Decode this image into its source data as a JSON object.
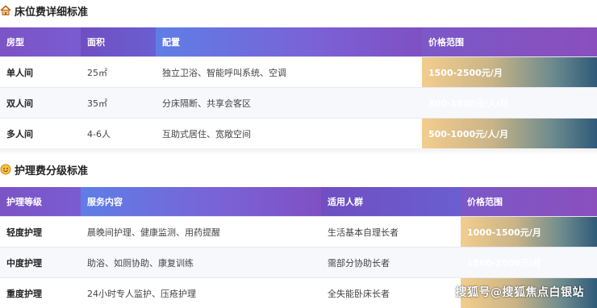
{
  "bed_section": {
    "title": "床位费详细标准",
    "icon": "house-icon",
    "headers": [
      "房型",
      "面积",
      "配置",
      "价格范围"
    ],
    "rows": [
      {
        "type": "单人间",
        "area": "25㎡",
        "config": "独立卫浴、智能呼叫系统、空调",
        "price": "1500-2500元/月"
      },
      {
        "type": "双人间",
        "area": "35㎡",
        "config": "分床隔断、共享会客区",
        "price": "800-1500元/人/月"
      },
      {
        "type": "多人间",
        "area": "4-6人",
        "config": "互助式居住、宽敞空间",
        "price": "500-1000元/人/月"
      }
    ]
  },
  "care_section": {
    "title": "护理费分级标准",
    "icon": "smile-coin-icon",
    "headers": [
      "护理等级",
      "服务内容",
      "适用人群",
      "价格范围"
    ],
    "rows": [
      {
        "level": "轻度护理",
        "service": "晨晚间护理、健康监测、用药提醒",
        "group": "生活基本自理长者",
        "price": "1000-1500元/月"
      },
      {
        "level": "中度护理",
        "service": "助浴、如厕协助、康复训练",
        "group": "需部分协助长者",
        "price": "1500-2500元/月"
      },
      {
        "level": "重度护理",
        "service": "24小时专人监护、压疮护理",
        "group": "全失能卧床长者",
        "price": ""
      }
    ]
  },
  "watermark": "搜狐号@搜狐焦点白银站",
  "colors": {
    "header_purple": "#6a5ed0",
    "price_gold": "#f3cd8e",
    "price_teal": "#2f5a78"
  }
}
